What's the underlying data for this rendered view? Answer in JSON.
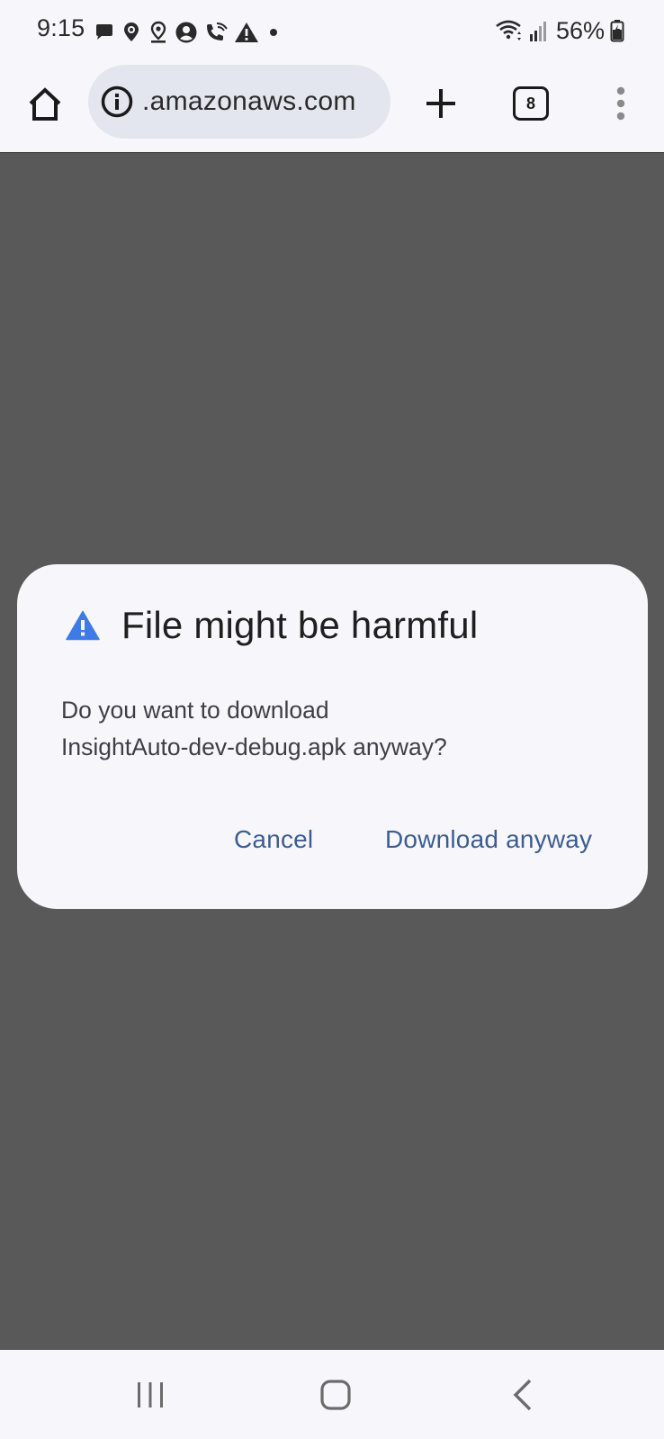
{
  "status_bar": {
    "time": "9:15",
    "battery_percent": "56%",
    "left_icons": [
      "chat-bubble-icon",
      "location-pin-icon",
      "map-pin-icon",
      "account-circle-icon",
      "wifi-calling-icon",
      "warning-icon",
      "dot-icon"
    ],
    "right_icons": [
      "wifi-icon",
      "signal-icon",
      "battery-icon"
    ]
  },
  "toolbar": {
    "url": ".amazonaws.com",
    "tab_count": "8",
    "home_icon": "home-icon",
    "info_icon": "info-icon",
    "new_tab_icon": "plus-icon",
    "menu_icon": "more-vert-icon"
  },
  "dialog": {
    "title": "File might be harmful",
    "message_line1": "Do you want to download",
    "message_line2": "InsightAuto-dev-debug.apk anyway?",
    "cancel_label": "Cancel",
    "download_label": "Download anyway",
    "warning_color": "#3f7be6",
    "action_color": "#3c5d8f"
  },
  "nav_bar": {
    "icons": [
      "recents-icon",
      "home-outline-icon",
      "back-icon"
    ]
  },
  "colors": {
    "scrim": "#595959",
    "surface": "#f7f7fb",
    "omnibox": "#e3e6ee"
  }
}
